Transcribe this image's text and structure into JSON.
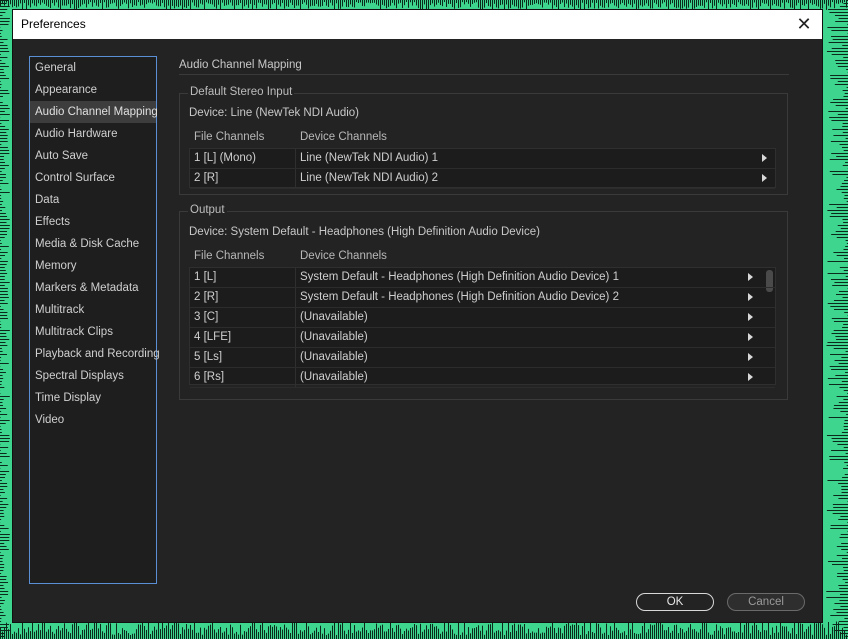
{
  "window": {
    "title": "Preferences",
    "close_glyph": "✕"
  },
  "sidebar": {
    "items": [
      {
        "label": "General"
      },
      {
        "label": "Appearance"
      },
      {
        "label": "Audio Channel Mapping",
        "selected": true
      },
      {
        "label": "Audio Hardware"
      },
      {
        "label": "Auto Save"
      },
      {
        "label": "Control Surface"
      },
      {
        "label": "Data"
      },
      {
        "label": "Effects"
      },
      {
        "label": "Media & Disk Cache"
      },
      {
        "label": "Memory"
      },
      {
        "label": "Markers & Metadata"
      },
      {
        "label": "Multitrack"
      },
      {
        "label": "Multitrack Clips"
      },
      {
        "label": "Playback and Recording"
      },
      {
        "label": "Spectral Displays"
      },
      {
        "label": "Time Display"
      },
      {
        "label": "Video"
      }
    ]
  },
  "main": {
    "section_title": "Audio Channel Mapping",
    "stereo_input": {
      "group_label": "Default Stereo Input",
      "device": "Device: Line (NewTek NDI Audio)",
      "col_file": "File Channels",
      "col_device": "Device Channels",
      "rows": [
        {
          "file": "1 [L] (Mono)",
          "device": "Line (NewTek NDI Audio) 1"
        },
        {
          "file": "2 [R]",
          "device": "Line (NewTek NDI Audio) 2"
        }
      ]
    },
    "output": {
      "group_label": "Output",
      "device": "Device: System Default - Headphones (High Definition Audio Device)",
      "col_file": "File Channels",
      "col_device": "Device Channels",
      "rows": [
        {
          "file": "1 [L]",
          "device": "System Default - Headphones (High Definition Audio Device) 1"
        },
        {
          "file": "2 [R]",
          "device": "System Default - Headphones (High Definition Audio Device) 2"
        },
        {
          "file": "3 [C]",
          "device": "(Unavailable)"
        },
        {
          "file": "4 [LFE]",
          "device": "(Unavailable)"
        },
        {
          "file": "5 [Ls]",
          "device": "(Unavailable)"
        },
        {
          "file": "6 [Rs]",
          "device": "(Unavailable)"
        }
      ]
    }
  },
  "buttons": {
    "ok": "OK",
    "cancel": "Cancel"
  },
  "colors": {
    "background_accent": "#3ed68e",
    "dialog_bg": "#232323",
    "selection_border": "#5a8fd6"
  }
}
